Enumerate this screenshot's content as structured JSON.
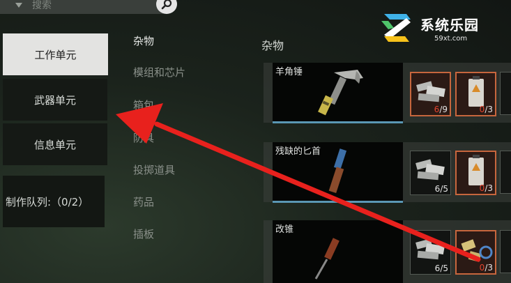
{
  "search": {
    "placeholder": "搜索",
    "icon": "search-icon"
  },
  "left_panel": {
    "buttons": [
      {
        "label": "工作单元",
        "active": true
      },
      {
        "label": "武器单元",
        "active": false
      },
      {
        "label": "信息单元",
        "active": false
      }
    ],
    "queue_label": "制作队列:（0/2）"
  },
  "categories": [
    "杂物",
    "模组和芯片",
    "箱包",
    "防具",
    "投掷道具",
    "药品",
    "插板"
  ],
  "section_title": "杂物",
  "items": [
    {
      "name": "羊角锤",
      "materials": [
        {
          "have": "6",
          "need": "9",
          "lacking": true
        },
        {
          "have": "0",
          "need": "3",
          "lacking": true
        }
      ]
    },
    {
      "name": "残缺的匕首",
      "materials": [
        {
          "have": "6",
          "need": "5",
          "lacking": false
        },
        {
          "have": "0",
          "need": "3",
          "lacking": true
        }
      ]
    },
    {
      "name": "改锥",
      "materials": [
        {
          "have": "6",
          "need": "5",
          "lacking": false
        },
        {
          "have": "0",
          "need": "3",
          "lacking": true
        }
      ]
    }
  ],
  "watermark": {
    "brand": "系统乐园",
    "url": "59xt.com"
  },
  "colors": {
    "arrow": "#e8211d",
    "lacking": "#e2442f",
    "accent": "#5a97b4"
  }
}
